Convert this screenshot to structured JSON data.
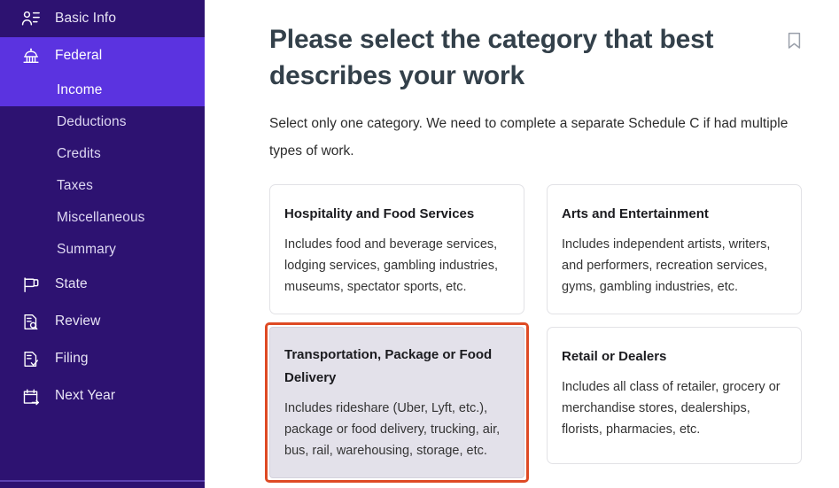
{
  "sidebar": {
    "items": [
      {
        "label": "Basic Info",
        "icon": "contact-person-icon",
        "type": "section",
        "active": false
      },
      {
        "label": "Federal",
        "icon": "capitol-building-icon",
        "type": "section",
        "active": true
      },
      {
        "label": "Income",
        "icon": "",
        "type": "sub",
        "active": true
      },
      {
        "label": "Deductions",
        "icon": "",
        "type": "sub",
        "active": false
      },
      {
        "label": "Credits",
        "icon": "",
        "type": "sub",
        "active": false
      },
      {
        "label": "Taxes",
        "icon": "",
        "type": "sub",
        "active": false
      },
      {
        "label": "Miscellaneous",
        "icon": "",
        "type": "sub",
        "active": false
      },
      {
        "label": "Summary",
        "icon": "",
        "type": "sub",
        "active": false
      },
      {
        "label": "State",
        "icon": "flag-icon",
        "type": "section",
        "active": false
      },
      {
        "label": "Review",
        "icon": "document-search-icon",
        "type": "section",
        "active": false
      },
      {
        "label": "Filing",
        "icon": "document-check-icon",
        "type": "section",
        "active": false
      },
      {
        "label": "Next Year",
        "icon": "calendar-arrow-icon",
        "type": "section",
        "active": false
      }
    ]
  },
  "main": {
    "title": "Please select the category that best describes your work",
    "subtitle": "Select only one category. We need to complete a separate Schedule C if had multiple types of work.",
    "bookmark_icon": "bookmark-icon",
    "cards": [
      {
        "title": "Hospitality and Food Services",
        "desc": "Includes food and beverage services, lodging services, gambling industries, museums, spectator sports, etc.",
        "selected": false
      },
      {
        "title": "Arts and Entertainment",
        "desc": "Includes independent artists, writers, and performers, recreation services, gyms, gambling industries, etc.",
        "selected": false
      },
      {
        "title": "Transportation, Package or Food Delivery",
        "desc": "Includes rideshare (Uber, Lyft, etc.), package or food delivery, trucking, air, bus, rail, warehousing, storage, etc.",
        "selected": true
      },
      {
        "title": "Retail or Dealers",
        "desc": "Includes all class of retailer, grocery or merchandise stores, dealerships, florists, pharmacies, etc.",
        "selected": false
      }
    ]
  },
  "colors": {
    "sidebar_bg": "#2d1271",
    "sidebar_active": "#5b33e0",
    "selected_card_ring": "#de4a24",
    "selected_card_fill": "#e3e1ea",
    "title_text": "#33404a"
  }
}
